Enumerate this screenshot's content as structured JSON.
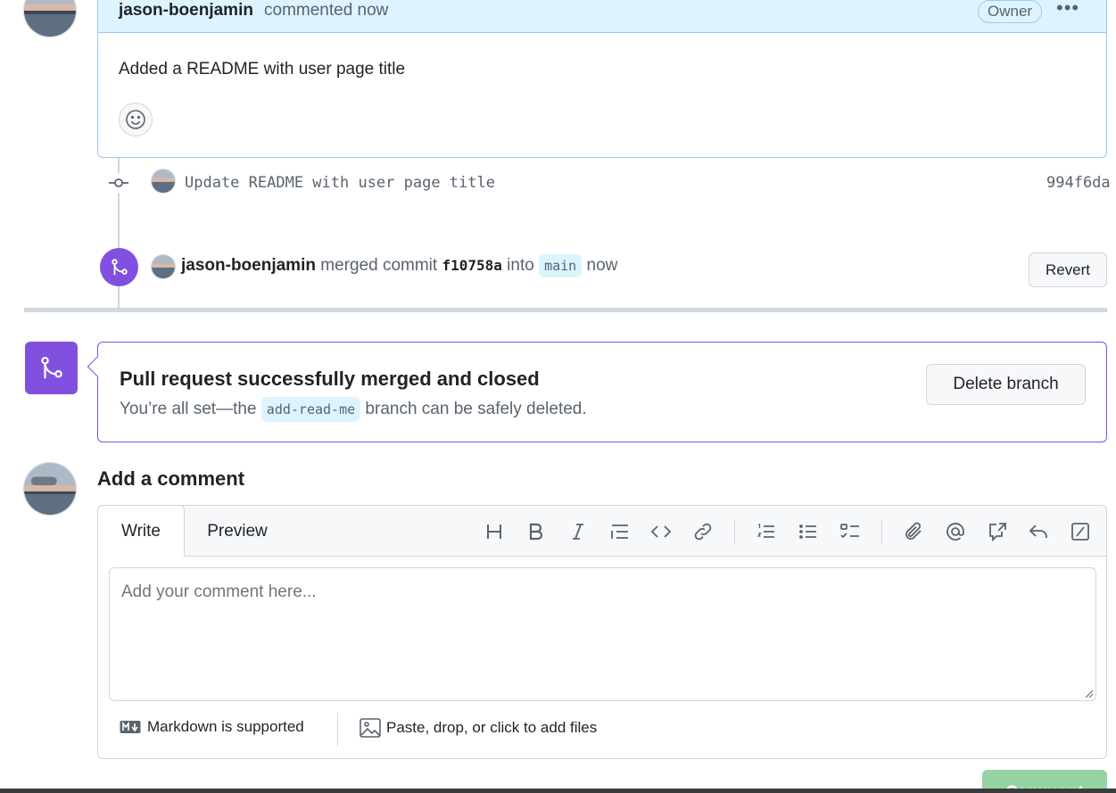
{
  "comment": {
    "author": "jason-boenjamin",
    "meta": "commented now",
    "badge": "Owner",
    "menu": "•••",
    "body": "Added a README with user page title"
  },
  "commit": {
    "message": "Update README with user page title",
    "sha": "994f6da"
  },
  "merge_event": {
    "author": "jason-boenjamin",
    "action": "merged commit",
    "sha": "f10758a",
    "into": "into",
    "branch": "main",
    "time": "now",
    "revert_label": "Revert"
  },
  "merged_box": {
    "title": "Pull request successfully merged and closed",
    "sub_prefix": "You’re all set—the",
    "branch": "add-read-me",
    "sub_suffix": "branch can be safely deleted.",
    "delete_label": "Delete branch"
  },
  "add_comment": {
    "title": "Add a comment",
    "tab_write": "Write",
    "tab_preview": "Preview",
    "placeholder": "Add your comment here...",
    "markdown_note": "Markdown is supported",
    "files_note": "Paste, drop, or click to add files",
    "submit_label": "Comment"
  },
  "colors": {
    "accent_purple": "#8250df",
    "header_blue": "#ddf4ff",
    "border_blue": "#9ec7ee",
    "submit_green": "#94d3a2"
  }
}
